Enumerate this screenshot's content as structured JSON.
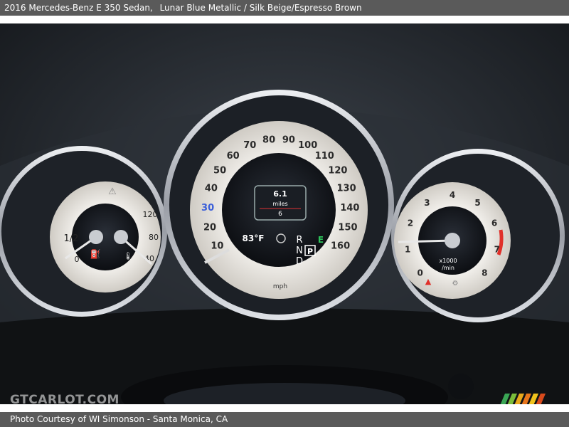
{
  "header": {
    "title": "2016 Mercedes-Benz E 350 Sedan,",
    "colors": "Lunar Blue Metallic / Silk Beige/Espresso Brown"
  },
  "footer": {
    "credit": "Photo Courtesy of WI Simonson - Santa Monica, CA"
  },
  "watermark": "GTCARLOT.COM",
  "speedometer": {
    "ticks": [
      "10",
      "20",
      "30",
      "40",
      "50",
      "60",
      "70",
      "80",
      "90",
      "100",
      "110",
      "120",
      "130",
      "140",
      "150",
      "160"
    ],
    "unit": "mph",
    "display": {
      "top": "6.1",
      "mid": "miles",
      "bottom": "6"
    },
    "temperature": "83°F",
    "gears": [
      "R",
      "N",
      "D"
    ],
    "park": "P",
    "eco": "E"
  },
  "left_gauge": {
    "fuel_labels": [
      "0",
      "1/2"
    ],
    "temp_labels": [
      "120",
      "80",
      "40"
    ]
  },
  "tachometer": {
    "ticks": [
      "0",
      "1",
      "2",
      "3",
      "4",
      "5",
      "6",
      "7",
      "8"
    ],
    "unit_top": "x1000",
    "unit_bottom": "/min"
  },
  "colors": {
    "accent_red": "#e0302a",
    "eco_green": "#2dc25a",
    "dial_face": "#e8e6e1",
    "chrome": "#c9ccd1"
  }
}
